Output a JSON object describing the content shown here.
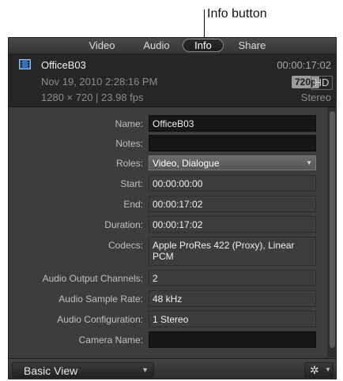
{
  "callout": {
    "label": "Info button"
  },
  "tabs": [
    {
      "label": "Video"
    },
    {
      "label": "Audio"
    },
    {
      "label": "Info"
    },
    {
      "label": "Share"
    }
  ],
  "clip": {
    "name": "OfficeB03",
    "duration": "00:00:17:02",
    "date": "Nov 19, 2010 2:28:16 PM",
    "format": "1280 × 720 | 23.98 fps",
    "resolution_badge": "720p",
    "hd_badge": "HD",
    "channels": "Stereo"
  },
  "properties": [
    {
      "label": "Name:",
      "value": "OfficeB03"
    },
    {
      "label": "Notes:",
      "value": ""
    },
    {
      "label": "Roles:",
      "value": "Video, Dialogue"
    },
    {
      "label": "Start:",
      "value": "00:00:00:00"
    },
    {
      "label": "End:",
      "value": "00:00:17:02"
    },
    {
      "label": "Duration:",
      "value": "00:00:17:02"
    },
    {
      "label": "Codecs:",
      "value": "Apple ProRes 422 (Proxy), Linear PCM"
    },
    {
      "label": "Audio Output Channels:",
      "value": "2"
    },
    {
      "label": "Audio Sample Rate:",
      "value": "48 kHz"
    },
    {
      "label": "Audio Configuration:",
      "value": "1 Stereo"
    },
    {
      "label": "Camera Name:",
      "value": ""
    }
  ],
  "footer": {
    "view_label": "Basic View"
  },
  "icons": {
    "film": "film-clip-icon",
    "popup_arrow": "chevron-down-icon",
    "gear": "gear-icon"
  }
}
